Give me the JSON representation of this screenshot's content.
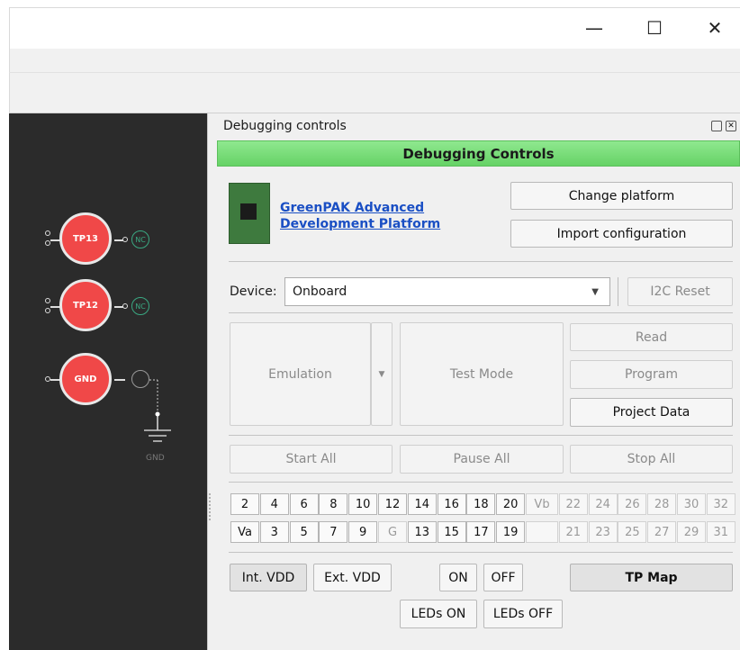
{
  "window": {
    "min_glyph": "—",
    "max_glyph": "☐",
    "close_glyph": "✕"
  },
  "canvas": {
    "tp13": "TP13",
    "tp12": "TP12",
    "gnd": "GND",
    "nc1": "NC",
    "nc2": "NC",
    "gnd_label": "GND"
  },
  "panel": {
    "title": "Debugging controls",
    "header": "Debugging Controls",
    "platform_link_line1": "GreenPAK Advanced",
    "platform_link_line2": "Development Platform",
    "change_platform": "Change platform",
    "import_config": "Import configuration",
    "device_label": "Device:",
    "device_value": "Onboard",
    "i2c_reset": "I2C Reset",
    "emulation": "Emulation",
    "test_mode": "Test Mode",
    "read": "Read",
    "program": "Program",
    "project_data": "Project Data",
    "start_all": "Start All",
    "pause_all": "Pause All",
    "stop_all": "Stop All",
    "pins_top": [
      "2",
      "4",
      "6",
      "8",
      "10",
      "12",
      "14",
      "16",
      "18",
      "20",
      "Vb",
      "22",
      "24",
      "26",
      "28",
      "30",
      "32"
    ],
    "pins_bottom": [
      "Va",
      "3",
      "5",
      "7",
      "9",
      "G",
      "13",
      "15",
      "17",
      "19",
      "",
      "21",
      "23",
      "25",
      "27",
      "29",
      "31"
    ],
    "int_vdd": "Int. VDD",
    "ext_vdd": "Ext. VDD",
    "on": "ON",
    "off": "OFF",
    "tp_map": "TP Map",
    "leds_on": "LEDs ON",
    "leds_off": "LEDs OFF"
  }
}
